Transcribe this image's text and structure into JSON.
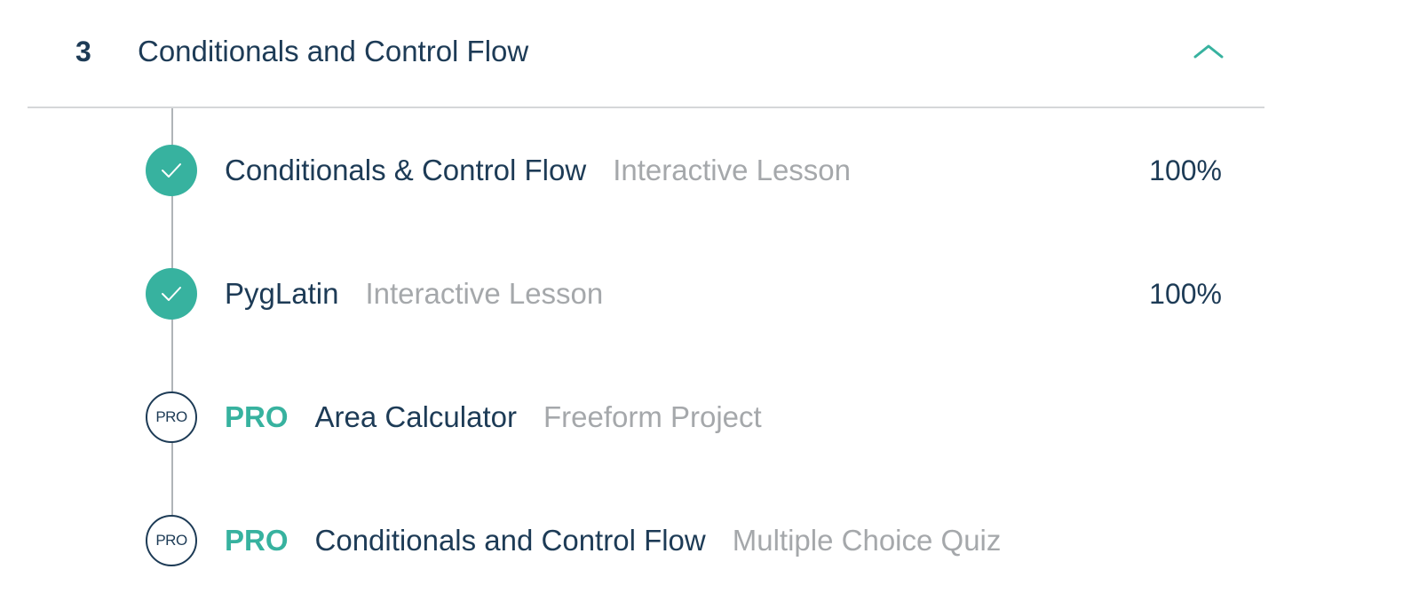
{
  "unit": {
    "number": "3",
    "title": "Conditionals and Control Flow",
    "toggle_icon": "chevron-up-icon",
    "accent_color": "#37b29f",
    "text_color": "#1d3b56",
    "muted_color": "#a5a8ab"
  },
  "lessons": [
    {
      "name": "Conditionals & Control Flow",
      "type": "Interactive Lesson",
      "progress": "100%",
      "status": "completed",
      "status_icon": "checkmark-icon"
    },
    {
      "name": "PygLatin",
      "type": "Interactive Lesson",
      "progress": "100%",
      "status": "completed",
      "status_icon": "checkmark-icon"
    },
    {
      "name": "Area Calculator",
      "type": "Freeform Project",
      "status": "pro",
      "badge_text": "PRO",
      "pro_label": "PRO"
    },
    {
      "name": "Conditionals and Control Flow",
      "type": "Multiple Choice Quiz",
      "status": "pro",
      "badge_text": "PRO",
      "pro_label": "PRO"
    }
  ]
}
